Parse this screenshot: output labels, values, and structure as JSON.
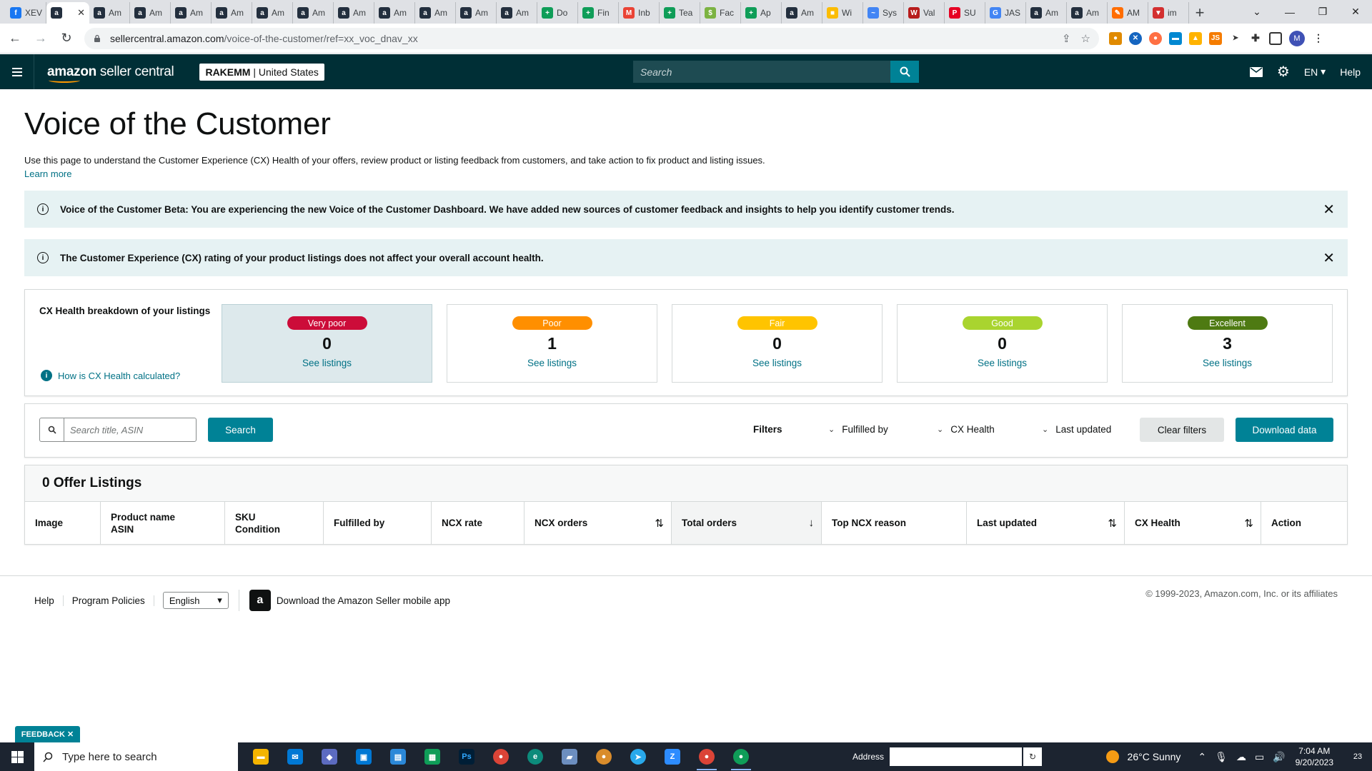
{
  "browser": {
    "tabs": [
      {
        "label": "XEV",
        "color": "#1877f2",
        "glyph": "f"
      },
      {
        "label": "",
        "color": "#232f3e",
        "glyph": "a",
        "active": true
      },
      {
        "label": "Am",
        "color": "#232f3e",
        "glyph": "a"
      },
      {
        "label": "Am",
        "color": "#232f3e",
        "glyph": "a"
      },
      {
        "label": "Am",
        "color": "#232f3e",
        "glyph": "a"
      },
      {
        "label": "Am",
        "color": "#232f3e",
        "glyph": "a"
      },
      {
        "label": "Am",
        "color": "#232f3e",
        "glyph": "a"
      },
      {
        "label": "Am",
        "color": "#232f3e",
        "glyph": "a"
      },
      {
        "label": "Am",
        "color": "#232f3e",
        "glyph": "a"
      },
      {
        "label": "Am",
        "color": "#232f3e",
        "glyph": "a"
      },
      {
        "label": "Am",
        "color": "#232f3e",
        "glyph": "a"
      },
      {
        "label": "Am",
        "color": "#232f3e",
        "glyph": "a"
      },
      {
        "label": "Am",
        "color": "#232f3e",
        "glyph": "a"
      },
      {
        "label": "Do",
        "color": "#0f9d58",
        "glyph": "+"
      },
      {
        "label": "Fin",
        "color": "#0f9d58",
        "glyph": "+"
      },
      {
        "label": "Inb",
        "color": "#ea4335",
        "glyph": "M"
      },
      {
        "label": "Tea",
        "color": "#0f9d58",
        "glyph": "+"
      },
      {
        "label": "Fac",
        "color": "#7cb342",
        "glyph": "$"
      },
      {
        "label": "Ap",
        "color": "#0f9d58",
        "glyph": "+"
      },
      {
        "label": "Am",
        "color": "#232f3e",
        "glyph": "a"
      },
      {
        "label": "Wi",
        "color": "#fbbc04",
        "glyph": "■"
      },
      {
        "label": "Sys",
        "color": "#4285f4",
        "glyph": "~"
      },
      {
        "label": "Val",
        "color": "#b71c1c",
        "glyph": "W"
      },
      {
        "label": "SU",
        "color": "#e60023",
        "glyph": "P"
      },
      {
        "label": "JAS",
        "color": "#4285f4",
        "glyph": "G"
      },
      {
        "label": "Am",
        "color": "#232f3e",
        "glyph": "a"
      },
      {
        "label": "Am",
        "color": "#232f3e",
        "glyph": "a"
      },
      {
        "label": "AM",
        "color": "#ff6d00",
        "glyph": "✎"
      },
      {
        "label": "im",
        "color": "#d32f2f",
        "glyph": "▼"
      }
    ],
    "url_host": "sellercentral.amazon.com",
    "url_path": "/voice-of-the-customer/ref=xx_voc_dnav_xx",
    "profile_initial": "M"
  },
  "header": {
    "logo_bold": "amazon",
    "logo_rest": " seller central",
    "account_name": "RAKEMM",
    "account_region": "United States",
    "search_placeholder": "Search",
    "language": "EN",
    "help": "Help"
  },
  "page": {
    "title": "Voice of the Customer",
    "description": "Use this page to understand the Customer Experience (CX) Health of your offers, review product or listing feedback from customers, and take action to fix product and listing issues.",
    "learn_more": "Learn more"
  },
  "alerts": [
    {
      "text": "Voice of the Customer Beta: You are experiencing the new Voice of the Customer Dashboard. We have added new sources of customer feedback and insights to help you identify customer trends."
    },
    {
      "text": "The Customer Experience (CX) rating of your product listings does not affect your overall account health."
    }
  ],
  "cx_health": {
    "heading": "CX Health breakdown of your listings",
    "help_link": "How is CX Health calculated?",
    "cards": [
      {
        "label": "Very poor",
        "count": "0",
        "link": "See listings",
        "badge_color": "#cc0c39",
        "text_color": "#ffffff",
        "selected": true
      },
      {
        "label": "Poor",
        "count": "1",
        "link": "See listings",
        "badge_color": "#ff8f00",
        "text_color": "#ffffff"
      },
      {
        "label": "Fair",
        "count": "0",
        "link": "See listings",
        "badge_color": "#ffc400",
        "text_color": "#ffffff"
      },
      {
        "label": "Good",
        "count": "0",
        "link": "See listings",
        "badge_color": "#a9d42f",
        "text_color": "#ffffff"
      },
      {
        "label": "Excellent",
        "count": "3",
        "link": "See listings",
        "badge_color": "#4e7a12",
        "text_color": "#ffffff"
      }
    ]
  },
  "filters": {
    "search_placeholder": "Search title, ASIN",
    "search_button": "Search",
    "filters_label": "Filters",
    "fulfilled_by": "Fulfilled by",
    "cx_health": "CX Health",
    "last_updated": "Last updated",
    "clear_filters": "Clear filters",
    "download": "Download data"
  },
  "table": {
    "title": "0 Offer Listings",
    "columns": [
      {
        "line1": "Image",
        "line2": ""
      },
      {
        "line1": "Product name",
        "line2": "ASIN"
      },
      {
        "line1": "SKU",
        "line2": "Condition"
      },
      {
        "line1": "Fulfilled by",
        "line2": ""
      },
      {
        "line1": "NCX rate",
        "line2": ""
      },
      {
        "line1": "NCX orders",
        "line2": "",
        "sort": "⇅"
      },
      {
        "line1": "Total orders",
        "line2": "",
        "sort": "↓"
      },
      {
        "line1": "Top NCX reason",
        "line2": ""
      },
      {
        "line1": "Last updated",
        "line2": "",
        "sort": "⇅"
      },
      {
        "line1": "CX Health",
        "line2": "",
        "sort": "⇅"
      },
      {
        "line1": "Action",
        "line2": ""
      }
    ]
  },
  "footer": {
    "help": "Help",
    "policies": "Program Policies",
    "language": "English",
    "app_link": "Download the Amazon Seller mobile app",
    "copyright": "© 1999-2023, Amazon.com, Inc. or its affiliates"
  },
  "feedback": "FEEDBACK ✕",
  "taskbar": {
    "search_placeholder": "Type here to search",
    "address_label": "Address",
    "weather": "26°C  Sunny",
    "time": "7:04 AM",
    "date": "9/20/2023",
    "notification_count": "23"
  }
}
